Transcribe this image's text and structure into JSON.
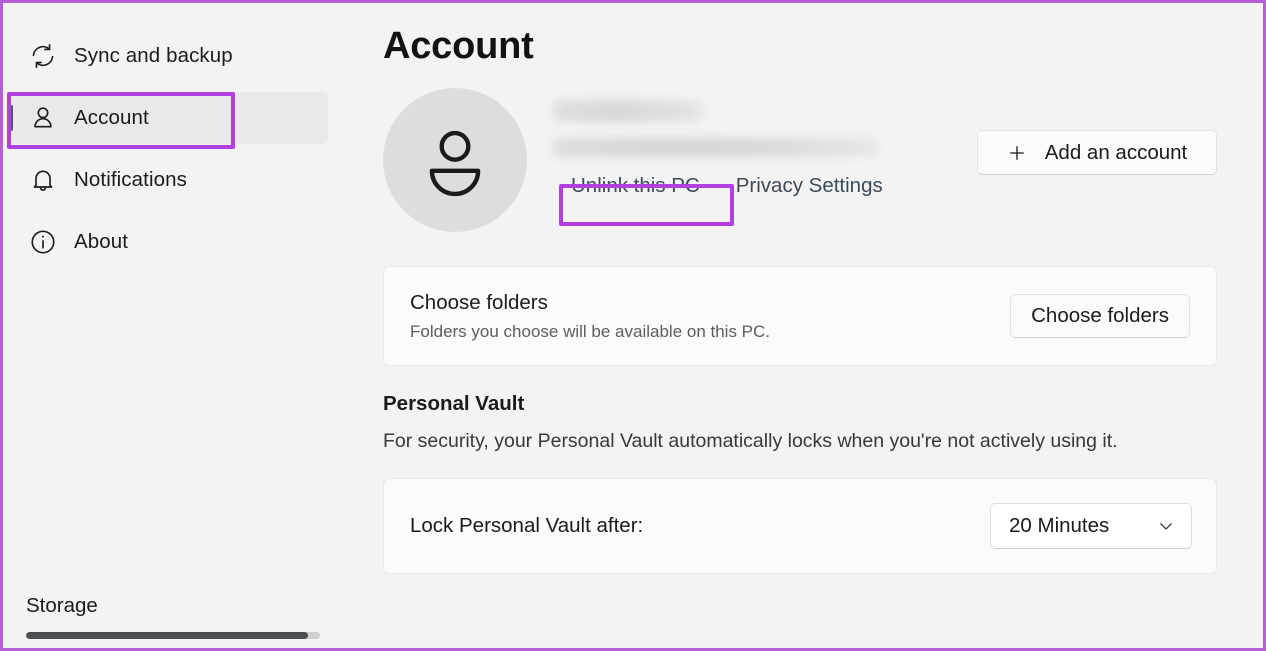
{
  "window": {
    "title": "Account"
  },
  "sidebar": {
    "items": [
      {
        "label": "Sync and backup",
        "icon": "sync-icon",
        "selected": false
      },
      {
        "label": "Account",
        "icon": "person-icon",
        "selected": true
      },
      {
        "label": "Notifications",
        "icon": "bell-icon",
        "selected": false
      },
      {
        "label": "About",
        "icon": "info-icon",
        "selected": false
      }
    ],
    "storage": {
      "label": "Storage",
      "bar_fill_percent": 96
    }
  },
  "main": {
    "page_title": "Account",
    "account": {
      "avatar_icon": "person-avatar-icon",
      "name": "",
      "email": "",
      "links": [
        {
          "label": "Unlink this PC",
          "highlighted": true
        },
        {
          "label": "Privacy Settings",
          "highlighted": false
        }
      ],
      "add_account_button": {
        "label": "Add an account",
        "icon": "plus-icon"
      }
    },
    "choose_folders": {
      "heading": "Choose folders",
      "subtext": "Folders you choose will be available on this PC.",
      "button_label": "Choose folders"
    },
    "personal_vault": {
      "section_title": "Personal Vault",
      "description": "For security, your Personal Vault automatically locks when you're not actively using it.",
      "lock_label": "Lock Personal Vault after:",
      "lock_value": "20 Minutes",
      "chevron_icon": "chevron-down-icon"
    }
  },
  "annotations": {
    "accent_color": "#b23fe0",
    "border_color": "#b45fd6",
    "selected_indicator_color": "#4a5a75",
    "link_color": "#3c4a59"
  }
}
